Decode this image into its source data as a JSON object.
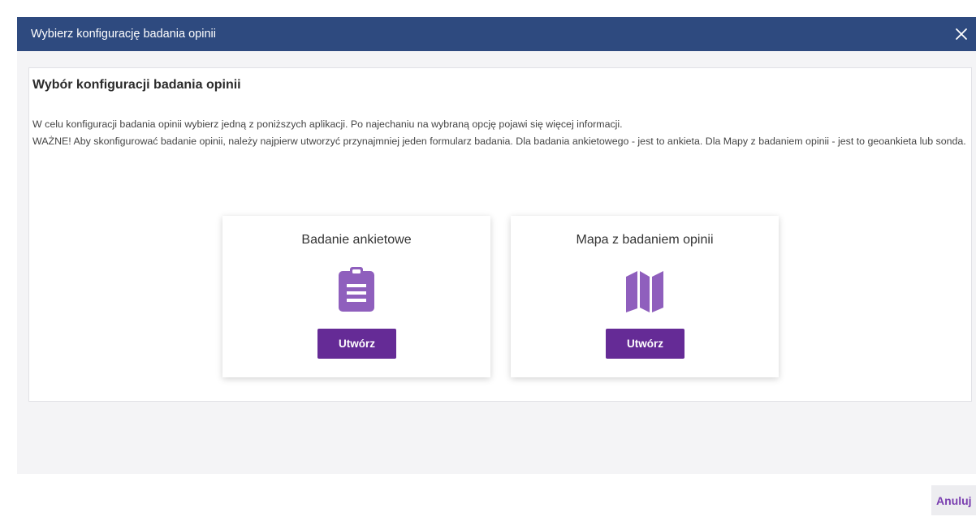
{
  "dialog": {
    "title": "Wybierz konfigurację badania opinii",
    "close_icon": "close-icon"
  },
  "panel": {
    "heading": "Wybór konfiguracji badania opinii",
    "paragraph1": "W celu konfiguracji badania opinii wybierz jedną z poniższych aplikacji. Po najechaniu na wybraną opcję pojawi się więcej informacji.",
    "paragraph2": "WAŻNE! Aby skonfigurować badanie opinii, należy najpierw utworzyć przynajmniej jeden formularz badania. Dla badania ankietowego - jest to ankieta. Dla Mapy z badaniem opinii - jest to geoankieta lub sonda."
  },
  "cards": [
    {
      "title": "Badanie ankietowe",
      "icon": "clipboard-list-icon",
      "button_label": "Utwórz"
    },
    {
      "title": "Mapa z badaniem opinii",
      "icon": "folded-map-icon",
      "button_label": "Utwórz"
    }
  ],
  "footer": {
    "cancel_label": "Anuluj"
  },
  "colors": {
    "header_bg": "#2e4a7f",
    "accent_purple": "#652b96",
    "icon_purple": "#8f5fbd",
    "cancel_text": "#7a3fb0"
  }
}
